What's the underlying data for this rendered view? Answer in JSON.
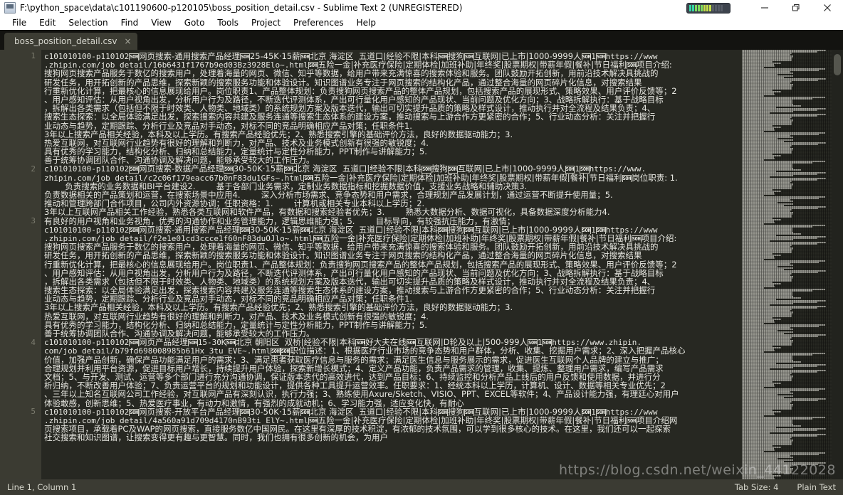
{
  "window": {
    "title": "F:\\python_space\\data\\c101190600-p120105\\boss_position_detail.csv - Sublime Text 2 (UNREGISTERED)",
    "app_icon": "sublime-text-icon",
    "minimize_label": "—",
    "maximize_label": "❐",
    "close_label": "✕",
    "gauge_name": "system-resource-gauge"
  },
  "menu": {
    "items": [
      {
        "label": "File"
      },
      {
        "label": "Edit"
      },
      {
        "label": "Selection"
      },
      {
        "label": "Find"
      },
      {
        "label": "View"
      },
      {
        "label": "Goto"
      },
      {
        "label": "Tools"
      },
      {
        "label": "Project"
      },
      {
        "label": "Preferences"
      },
      {
        "label": "Help"
      }
    ]
  },
  "tabs": [
    {
      "label": "boss_position_detail.csv",
      "close": "×",
      "active": true
    }
  ],
  "editor": {
    "line_numbers": [
      "1",
      "2",
      "3",
      "4",
      "5"
    ],
    "soh_glyph": "SOH",
    "lines": [
      "c101010100-p110102[SOH]网页搜索-通用搜索产品经理[SOH]25-45K·15薪[SOH]北京 海淀区  五道口|经验不限|本科[SOH]搜狗[SOH]互联网|已上市|1000-9999人[SOH]1[SOH]https://www",
      ".zhipin.com/job_detail/16b6431f1767b9ed03Bz3928Elo~.html[SOH]五险一金|补充医疗保险|定期体检|加班补助|年终奖|股票期权|带薪年假|餐补|节日福利[SOH]项目介绍:",
      "搜狗网页搜索产品服务于数亿的搜索用户，处理着海量的网页、微信、知乎等数据，给用户带来充满惊喜的搜索体验和服务。团队鼓励开拓创新，用前沿技术解决具挑战的",
      "研发任务，用开拓创新的产品思维，探索新颖的搜索服务功能和体验设计。知识图谱业务专注于网页搜索的结构化产品，通过整合海量的网页碎片化信息，对搜索结果",
      "行重新优化计算，把最核心的信息展现给用户。岗位职责1、产品整体规划：负责搜狗网页搜索产品的整体产品规划，包括搜索产品的展现形式、策略效果、用户评价反馈等；2",
      "、用户感知评估：从用户视角出发，分析用户行为及路径，不断迭代评测体系，产出可行量化用户感知的产品现状、当前问题及优化方向；3、战略拆解执行：基于战略目标",
      "，拆解出各类需求（包括但不限于时效类、人物类、地域类）的系统规划方案及版本迭代，输出可切实提升品质的策略及样式设计，推动执行并对全流程及结果负责；4、",
      "搜索生态探索：以全局体验满足出发，探索搜索内容共建及服务连通等搜索生态体系的建设方案，推动搜索与上游合作方更紧密的合作；5、行业动态分析：关注并把握行",
      "业动态与趋势，定期跟踪、分析行业及竞品对手动态，对标不同的竞品明确相应产品对策；任职条件1.",
      "3年以上搜索产品相关经验，本科及以上学历。有搜索产品经验优先；2、熟悉搜索引擎的基础评价方法，良好的数据驱动能力；3.",
      "热爱互联网，对互联网行业趋势有很好的理解和判断力，对产品、技术及业务模式创新有很强的敏锐度；4.",
      "具有优秀的学习能力，结构化分析、归纳和总结能力，定量统计与定性分析能力，PPT制作与讲解能力；5.",
      "善于统筹协调团队合作、沟通协调及解决问题，能够承受较大的工作压力。",
      "c101010100-p110102[SOH]网页搜索-数据产品经理[SOH]30-50K·15薪[SOH]北京 海淀区  五道口|经验不限|本科[SOH]搜狗[SOH]互联网|已上市|1000-9999人[SOH]1[SOH]https://www.",
      "zhipin.com/job_detail/c2c06f179eacc67b0nF83du1GFs~.html[SOH]五险一金|补充医疗保险|定期体检|加班补助|年终奖|股票期权|带薪年假|餐补|节日福利[SOH]岗位职责: 1.",
      "        负责搜索的业务数据和BI平台建设2.        基于各部门业务需求，定制业务数据指标和挖掘数据价值，支援业务战略和辅助决策3.",
      "负责数据相关的产品策划和运营，在搜索场景中应用4.        深入分析市场需求、竞争态势和用户需求，合理规划产品发展计划，通过运营不断提升使用量；5.",
      "推动和管理跨部门合作项目，公司内外资源协调；任职资格：1.        计算机或相关专业本科以上学历；2.",
      "3年以上互联网产品相关工作经验，熟悉各类互联网和软件产品，有数据和搜索经验者优先；3.        熟悉大数据分析、数据可视化，具备数据深度分析能力4.",
      "有良好的用户视角和业务视角，优秀的沟通协作和业务管理能力，逻辑思维能力强；5.        目标导向，有较强抗压能力，有激情；",
      "c101010100-p110102[SOH]网页搜索-通用搜索产品经理[SOH]30-50K·15薪[SOH]北京 海淀区  五道口|经验不限|本科[SOH]搜狗[SOH]互联网|已上市|1000-9999人[SOH]1[SOH]https://www",
      ".zhipin.com/job_detail/f2e1e01cd3ccce1f60nF83duOJlo~.html[SOH]五险一金|补充医疗保险|定期体检|加班补助|年终奖|股票期权|带薪年假|餐补|节日福利[SOH]项目介绍:",
      "搜狗网页搜索产品服务于数亿的搜索用户，处理着海量的网页、微信、知乎等数据，给用户带来充满惊喜的搜索体验和服务。团队鼓励开拓创新，用前沿技术解决具挑战的",
      "研发任务，用开拓创新的产品思维，探索新颖的搜索服务功能和体验设计。知识图谱业务专注于网页搜索的结构化产品，通过整合海量的网页碎片化信息，对搜索结果",
      "行重新优化计算，把最核心的信息展现给用户。岗位职责1、产品整体规划：负责搜狗网页搜索产品的整体产品规划，包括搜索产品的展现形式、策略效果、用户评价反馈等；2",
      "、用户感知评估：从用户视角出发，分析用户行为及路径，不断迭代评测体系，产出可行量化用户感知的产品现状、当前问题及优化方向；3、战略拆解执行：基于战略目标",
      "，拆解出各类需求（包括但不限于时效类、人物类、地域类）的系统规划方案及版本迭代，输出可切实提升品质的策略及样式设计，推动执行并对全流程及结果负责；4、",
      "搜索生态探索：以全局体验满足出发，探索搜索内容共建及服务连通等搜索生态体系的建设方案，推动搜索与上游合作方更紧密的合作；5、行业动态分析：关注并把握行",
      "业动态与趋势，定期跟踪、分析行业及竞品对手动态，对标不同的竞品明确相应产品对策；任职条件1.",
      "3年以上搜索产品相关经验，本科及以上学历。有搜索产品经验优先；2、熟悉搜索引擎的基础评价方法，良好的数据驱动能力；3.",
      "热爱互联网，对互联网行业趋势有很好的理解和判断力，对产品、技术及业务模式创新有很强的敏锐度；4.",
      "具有优秀的学习能力，结构化分析、归纳和总结能力，定量统计与定性分析能力，PPT制作与讲解能力；5.",
      "善于统筹协调团队合作、沟通协调及解决问题，能够承受较大的工作压力。",
      "c101010100-p110102[SOH]网页产品经理[SOH]15-30K[SOH]北京 朝阳区  双桥|经验不限|本科[SOH]好大夫在线[SOH]互联网|D轮及以上|500-999人[SOH]1[SOH]https://www.zhipin.",
      "com/job_detail/b79fd698008985b61Hx_3tu_EVE~.html[SOH][SOH]职位描述：1、根据医疗行业市场的竞争态势和用户群体，分析、收集、挖掘用户需求；2、深入把握产品核心",
      "价值，加强产品创新，确保产品功能满足用户的需求；3、满足患者获取医疗信息与服务的需求；满足医生信息与服务展示的需求，促进医生互联网个人品牌的建立与推广；",
      "合理规划并利用平台资源，促进目标用户增长，持续提升用户体验，探索新增长模式；4、定义产品功能，负责产品需求的管理，收集、提炼、整理用户需求，编写产品需求",
      "文档；5、与开发、测试、运营等多个部门进行充分沟通协调，保证版本迭代的高效进代，达到产品目标；6、持续监控和分析产品上线后的用户反馈和使用数据，并进行分",
      "析归纳，不断改善用户体验；7、负责运营平台的规划和功能设计，提供各种工具提升运营效率。任职要求：1、经统本科以上学历，计算机、设计、数据等相关专业优先；2",
      "、三年以上知名互联网公司工作经验，对互联网产品有深刻认识，执行力强；3、熟练使用Axure/Sketch、VISIO、PPT、EXCEL等软件；4、产品设计能力强，有理廷心对用户",
      "体验敢感，创新思维；5、热爱医疗事业，有动力和激情，有强烈的成就动机；6、学习能力强，适应变化快，有耐心",
      "c101010100-p110102[SOH]网页搜索-开放平台产品经理[SOH]30-50K·15薪[SOH]北京 海淀区  五道口|经验不限|本科[SOH]搜狗[SOH]互联网|已上市|1000-9999人[SOH]1[SOH]https://www",
      ".zhipin.com/job_detail/4a560a91d709d4170nB93ti_ElY~.html[SOH]五险一金|补充医疗保险|定期体检|加班补助|年终奖|股票期权|带薪年假|餐补|节日福利[SOH]项目介绍网",
      "页搜索项目，承载着PC及WAP的网页搜索，直接服务数亿中国网民。在这里有深厚的技术积淀，有浓郁的技术氛围，可以学到很多核心的技术。在这里，我们还可以一起探索",
      "社交搜索和知识图谱，让搜索变得更有趣与更智慧。同时，我们也拥有很多创新的机会，为用户"
    ],
    "line_number_rows": [
      0,
      13,
      19,
      33,
      41
    ]
  },
  "statusbar": {
    "position": "Line 1, Column 1",
    "tab_size": "Tab Size: 4",
    "syntax": "Plain Text"
  },
  "watermark": "https://blog.csdn.net/weixin_44122028",
  "colors": {
    "editor_bg": "#272822",
    "gutter_bg": "#3b3b32",
    "tabbar_bg": "#131310",
    "tab_active_bg": "#3c3c33",
    "statusbar_bg": "#3b3b33",
    "text_fg": "#e8e8e2",
    "titlebar_bg": "#ffffff"
  }
}
